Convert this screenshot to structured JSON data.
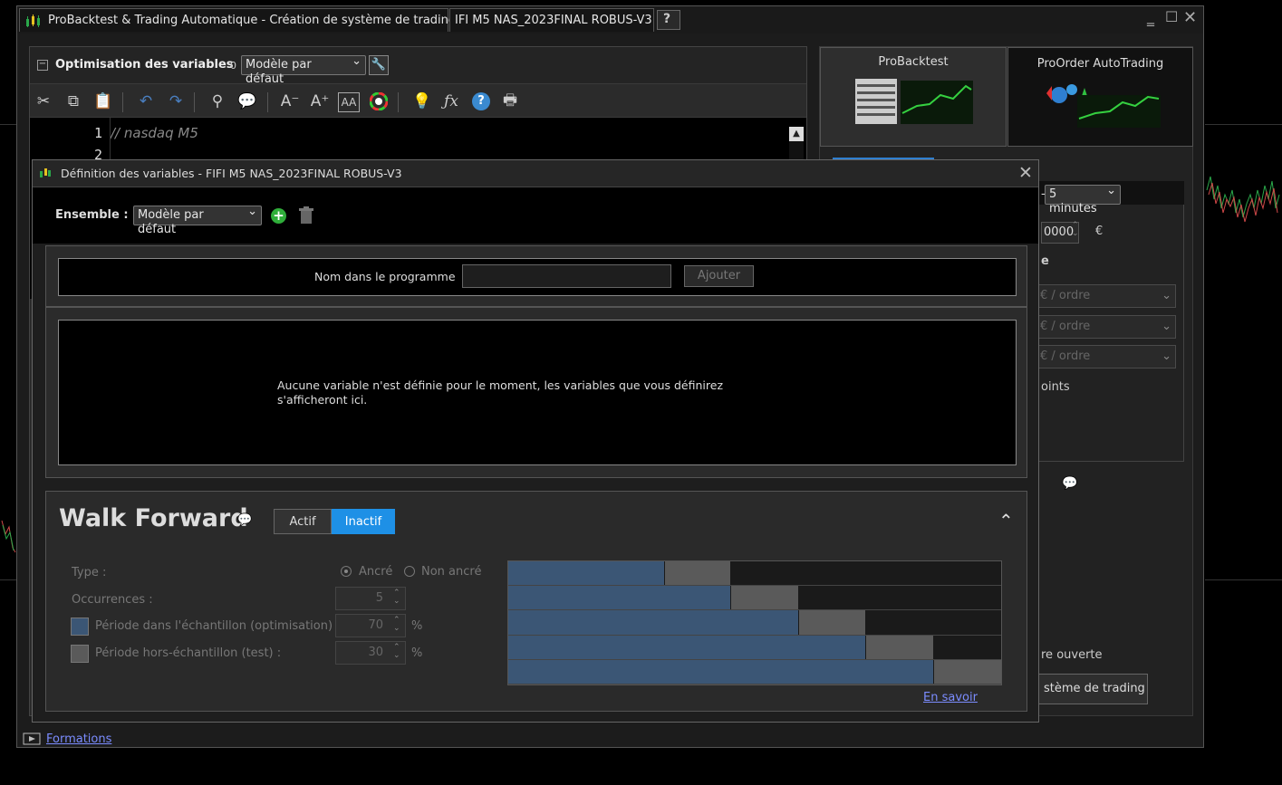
{
  "window": {
    "app_title": "ProBacktest & Trading Automatique - Création de système de trading",
    "doc_tab": "IFI M5 NAS_2023FINAL ROBUS-V3",
    "help_glyph": "?"
  },
  "editor": {
    "section_title": "Optimisation des variables",
    "variable_count": "0",
    "template_select": "Modèle par défaut",
    "lines": [
      {
        "no": "1",
        "text": "// nasdaq M5"
      },
      {
        "no": "2",
        "text": ""
      }
    ]
  },
  "right_panel": {
    "tab_probacktest": "ProBacktest",
    "tab_proorder": "ProOrder AutoTrading",
    "timeframe": "5 minutes",
    "capital_value": "0000",
    "currency": "€",
    "label_e": "e",
    "order_placeholders": [
      "€ / ordre",
      "€ / ordre",
      "€ / ordre"
    ],
    "points_label": "oints",
    "open_label": "re ouverte",
    "trading_button": "stème de trading"
  },
  "footer": {
    "formations_link": "Formations"
  },
  "dialog": {
    "title": "Définition des variables - FIFI M5 NAS_2023FINAL ROBUS-V3",
    "ensemble_label": "Ensemble :",
    "ensemble_select": "Modèle par défaut",
    "name_label": "Nom dans le programme",
    "name_input": "",
    "add_button": "Ajouter",
    "empty_message_line1": "Aucune variable n'est définie pour le moment, les variables que vous définirez",
    "empty_message_line2": "s'afficheront ici.",
    "walk_forward": {
      "title": "Walk Forward",
      "actif": "Actif",
      "inactif": "Inactif",
      "selected": "Inactif",
      "type_label": "Type :",
      "anchored": "Ancré",
      "non_anchored": "Non ancré",
      "anchored_selected": true,
      "occurrences_label": "Occurrences :",
      "occurrences_value": "5",
      "in_sample_label": "Période dans l'échantillon (optimisation)",
      "in_sample_value": "70",
      "out_sample_label": "Période hors-échantillon (test) :",
      "out_sample_value": "30",
      "percent": "%",
      "learn_more": "En savoir",
      "colors": {
        "in_sample": "#3b5675",
        "out_sample": "#5a5a5a",
        "active_button": "#1e90e6"
      },
      "bars": [
        {
          "in_end": 0.317,
          "out_end": 0.451
        },
        {
          "in_end": 0.451,
          "out_end": 0.588
        },
        {
          "in_end": 0.588,
          "out_end": 0.724
        },
        {
          "in_end": 0.724,
          "out_end": 0.862
        },
        {
          "in_end": 0.862,
          "out_end": 1.0
        }
      ]
    }
  }
}
